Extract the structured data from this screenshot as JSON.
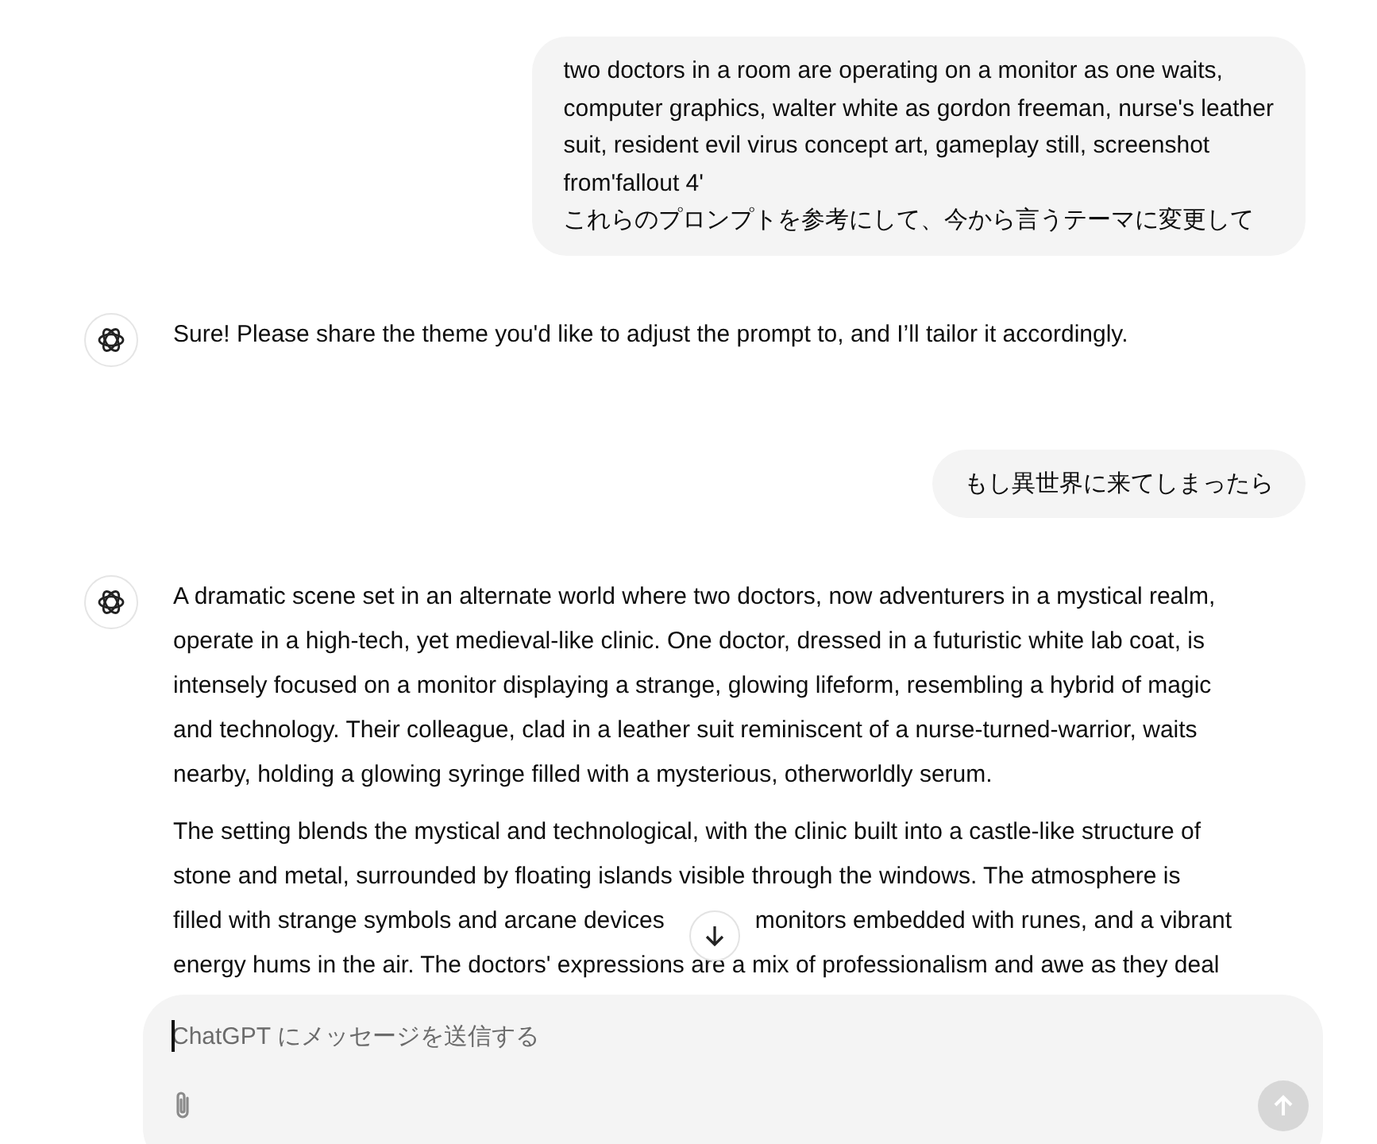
{
  "messages": [
    {
      "kind": "user",
      "lines": [
        "two doctors in a room are operating on a monitor as one waits,",
        "computer graphics, walter white as gordon freeman, nurse's leather",
        "suit, resident evil virus concept art, gameplay still, screenshot",
        "from'fallout 4'",
        "これらのプロンプトを参考にして、今から言うテーマに変更して"
      ]
    },
    {
      "kind": "assistant",
      "paragraphs": [
        [
          "Sure! Please share the theme you'd like to adjust the prompt to, and I’ll tailor it accordingly."
        ]
      ]
    },
    {
      "kind": "user",
      "lines": [
        "もし異世界に来てしまったら"
      ]
    },
    {
      "kind": "assistant",
      "paragraphs": [
        [
          "A dramatic scene set in an alternate world where two doctors, now adventurers in a mystical realm,",
          "operate in a high-tech, yet medieval-like clinic. One doctor, dressed in a futuristic white lab coat, is",
          "intensely focused on a monitor displaying a strange, glowing lifeform, resembling a hybrid of magic",
          "and technology. Their colleague, clad in a leather suit reminiscent of a nurse-turned-warrior, waits",
          "nearby, holding a glowing syringe filled with a mysterious, otherworldly serum."
        ],
        [
          "The setting blends the mystical and technological, with the clinic built into a castle-like structure of",
          "stone and metal, surrounded by floating islands visible through the windows. The atmosphere is",
          [
            "filled with strange symbols and arcane devices",
            "monitors embedded with runes, and a vibrant"
          ],
          "energy hums in the air. The doctors' expressions are a mix of professionalism and awe as they deal"
        ]
      ]
    }
  ],
  "composer": {
    "placeholder": "ChatGPT にメッセージを送信する"
  }
}
